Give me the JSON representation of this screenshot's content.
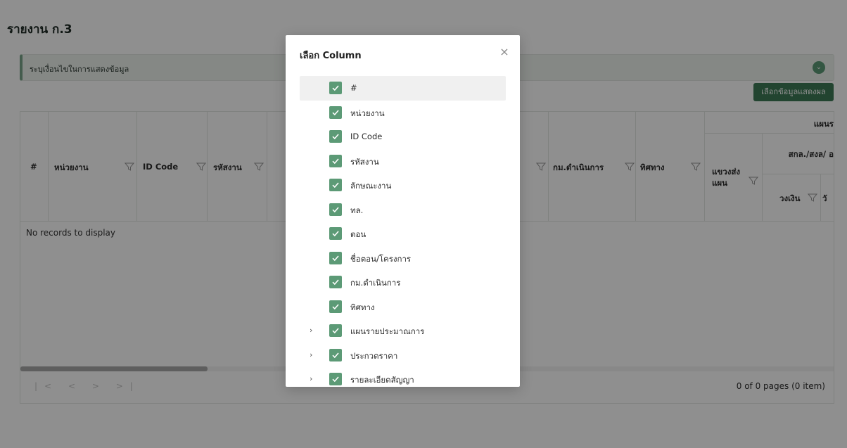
{
  "page": {
    "title": "รายงาน ก.3"
  },
  "criteria": {
    "label": "ระบุเงื่อนไขในการแสดงข้อมูล",
    "expand_icon": "chevron-down-icon"
  },
  "toolbar": {
    "select_data_label": "เลือกข้อมูลแสดงผล"
  },
  "grid": {
    "columns": [
      "#",
      "หน่วยงาน",
      "ID Code",
      "รหัสงาน",
      "กม.ดำเนินการ",
      "ทิศทาง",
      "แขวงส่งแผน"
    ],
    "group_header": "แผนร",
    "subgroup_header": "สกล./สงล/ อ",
    "sub_columns": [
      "วงเงิน",
      "วั"
    ],
    "empty_message": "No records to display",
    "scroll_position": 0.23,
    "pager": {
      "first": "|<",
      "prev": "<",
      "next": ">",
      "last": ">|",
      "info": "0 of 0 pages (0 item)"
    }
  },
  "modal": {
    "title": "เลือก Column",
    "close_icon": "close-icon",
    "items": [
      {
        "label": "#",
        "checked": true,
        "expandable": false
      },
      {
        "label": "หน่วยงาน",
        "checked": true,
        "expandable": false
      },
      {
        "label": "ID Code",
        "checked": true,
        "expandable": false
      },
      {
        "label": "รหัสงาน",
        "checked": true,
        "expandable": false
      },
      {
        "label": "ลักษณะงาน",
        "checked": true,
        "expandable": false
      },
      {
        "label": "ทล.",
        "checked": true,
        "expandable": false
      },
      {
        "label": "ตอน",
        "checked": true,
        "expandable": false
      },
      {
        "label": "ชื่อตอน/โครงการ",
        "checked": true,
        "expandable": false
      },
      {
        "label": "กม.ดำเนินการ",
        "checked": true,
        "expandable": false
      },
      {
        "label": "ทิศทาง",
        "checked": true,
        "expandable": false
      },
      {
        "label": "แผนรายประมาณการ",
        "checked": true,
        "expandable": true
      },
      {
        "label": "ประกวดราคา",
        "checked": true,
        "expandable": true
      },
      {
        "label": "รายละเอียดสัญญา",
        "checked": true,
        "expandable": true
      }
    ]
  },
  "colors": {
    "accent": "#5c9a76",
    "button": "#3e7a57"
  }
}
